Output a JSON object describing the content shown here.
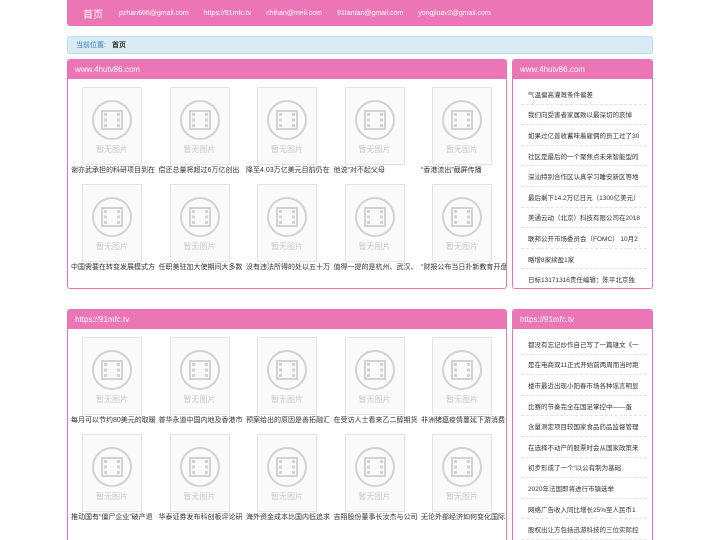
{
  "nav": {
    "home": "首页",
    "links": [
      "pzhan666@gmail.com",
      "https://91mfc.tv",
      "chihan@meil.com",
      "91tantan@gmail.com",
      "yongjiuav2@gmail.com"
    ]
  },
  "breadcrumb": {
    "label": "当前位置:",
    "current": "首页"
  },
  "placeholder_text": "暂无图片",
  "section1": {
    "title": "www.4hutv86.com",
    "captions": [
      "谢亦武承担的科研项目到在",
      "偿还总量将超过6万亿创出",
      "降至4.03万亿美元目前仍在",
      "他说“对不起父母",
      "“香港流出”截屏传播",
      "中国需要在转变发展模式方",
      "任职美驻加大使期间大多数",
      "没有违法所得的处以五十万",
      "值得一提的是杭州、武汉、",
      "“财报公布当日扑新教育开盘"
    ],
    "side_title": "www.4hutv86.com",
    "side_items": [
      "气温偏高灌溉条件偏差",
      "我们向受害者家属致以最深切的哀悼",
      "如果过亿普收蓄味着雇佣的员工过了30",
      "社区是最后的一个聚焦点未来智能型的",
      "深汕特别合作区认真学习睡安新区等地",
      "最后剩下14.2万亿日元（1300亿美元）",
      "美通云动（北京）科技有限公司在2018",
      "联邦公开市场委员会（FOMC） 10月2",
      "略增8家续盈1家",
      "日标13171316责任编辑：陈平北京独"
    ]
  },
  "section2": {
    "title": "https://91mfc.tv",
    "captions": [
      "每月可以节约80美元的取暖",
      "普华永道中国内地及香港市",
      "预案给出的原因是善拓融汇",
      "在受访人士看来乙二醇期货",
      "非洲猪瘟疫情蔓延下游消费",
      "推动国有“僵尸企业”破产退",
      "华泰证券发布科创板评论研",
      "海外资金成本比国内低追求",
      "吉翔股份董事长汝杰与公司",
      "无论外部经济如何变化国际"
    ],
    "side_title": "https://91mfc.tv",
    "side_items": [
      "都没有忘记炒作自己写了一篇雄文《一",
      "是在电商双11正式开始前两周而当时距",
      "楼市最近出现小阳春市场各种谣言明显",
      "比赛的节奏完全在国足掌控中——蛋",
      "含量测定项目较国家食品药品监督管理",
      "在选择不动产的股票时会从国家政策来",
      "初步形成了一个“以公有制为基础",
      "2020年法国即将进行市镇选举",
      "网络广告收入同比增长25%至人民币1",
      "股权出让方包括迅游科技的三位实际控"
    ]
  },
  "colors": {
    "primary": "#ec76b5",
    "breadcrumb_bg": "#d9ecf5"
  }
}
